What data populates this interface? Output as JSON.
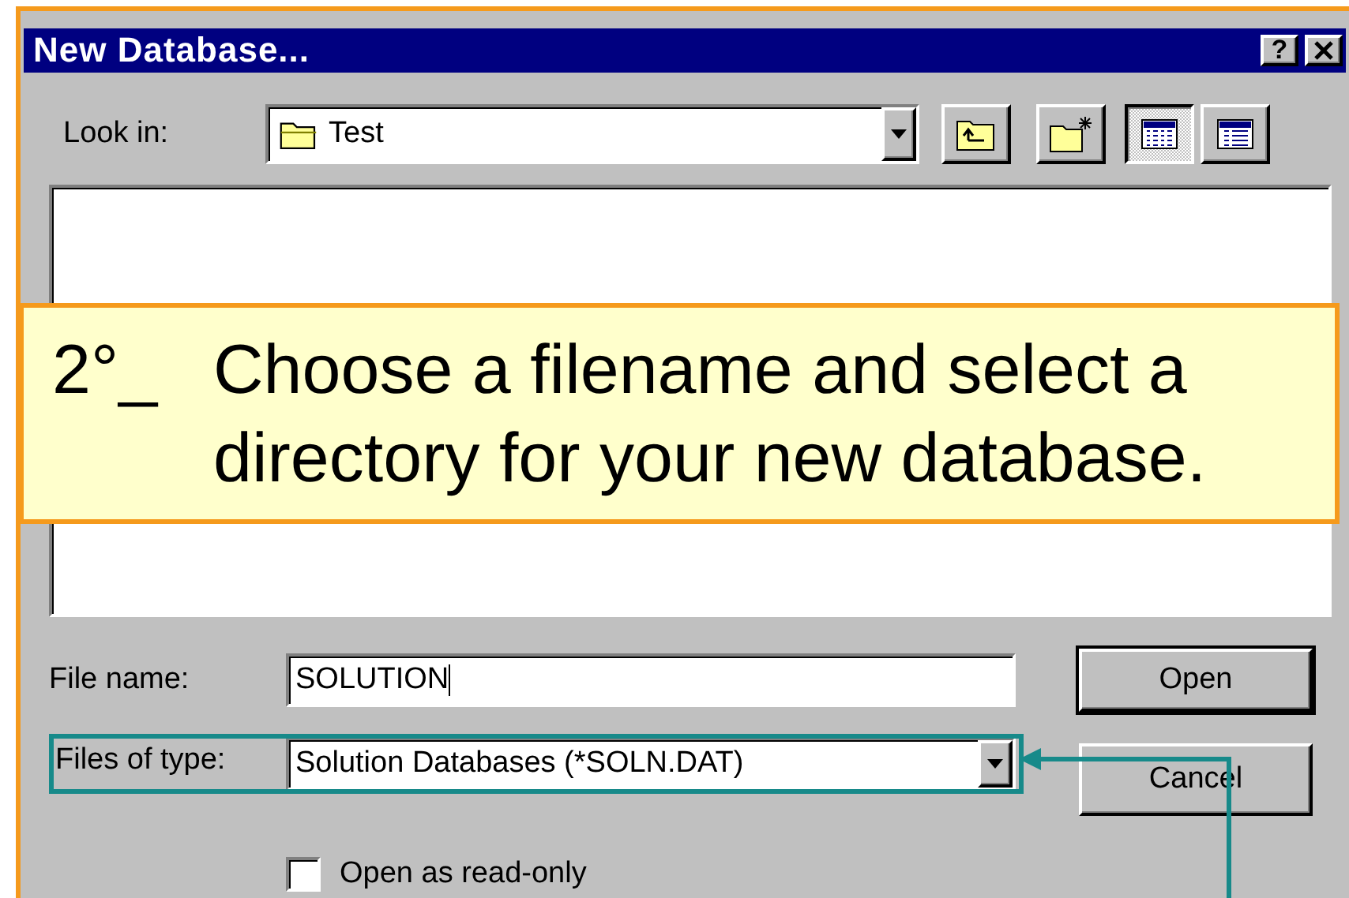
{
  "window": {
    "title": "New Database...",
    "help": "?"
  },
  "look_in": {
    "label": "Look in:",
    "value": "Test"
  },
  "view_modes": [
    {
      "kind": "list",
      "selected": true
    },
    {
      "kind": "details",
      "selected": false
    }
  ],
  "callout": {
    "number": "2°_",
    "text": "Choose a filename and select a directory for your new database."
  },
  "file_name": {
    "label": "File name:",
    "value": "SOLUTION"
  },
  "file_type": {
    "label": "Files of type:",
    "value": "Solution Databases (*SOLN.DAT)"
  },
  "read_only": {
    "label": "Open as read-only",
    "checked": false
  },
  "buttons": [
    {
      "label": "Open",
      "default": true
    },
    {
      "label": "Cancel",
      "default": false
    }
  ]
}
